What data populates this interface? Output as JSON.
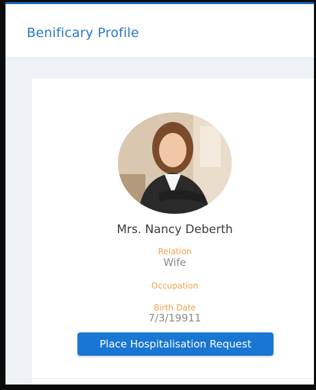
{
  "header": {
    "title": "Benificary Profile"
  },
  "profile": {
    "avatar_icon": "profile-photo",
    "name": "Mrs. Nancy Deberth",
    "relation_label": "Relation",
    "relation_value": "Wife",
    "occupation_label": "Occupation",
    "occupation_value": "",
    "birth_date_label": "Birth Date",
    "birth_date_value": "7/3/19911"
  },
  "actions": {
    "hospitalisation_label": "Place Hospitalisation Request"
  },
  "colors": {
    "accent": "#1976d2",
    "header_title": "#2a78c8",
    "label": "#f0a14a",
    "value": "#8a8a8a"
  }
}
